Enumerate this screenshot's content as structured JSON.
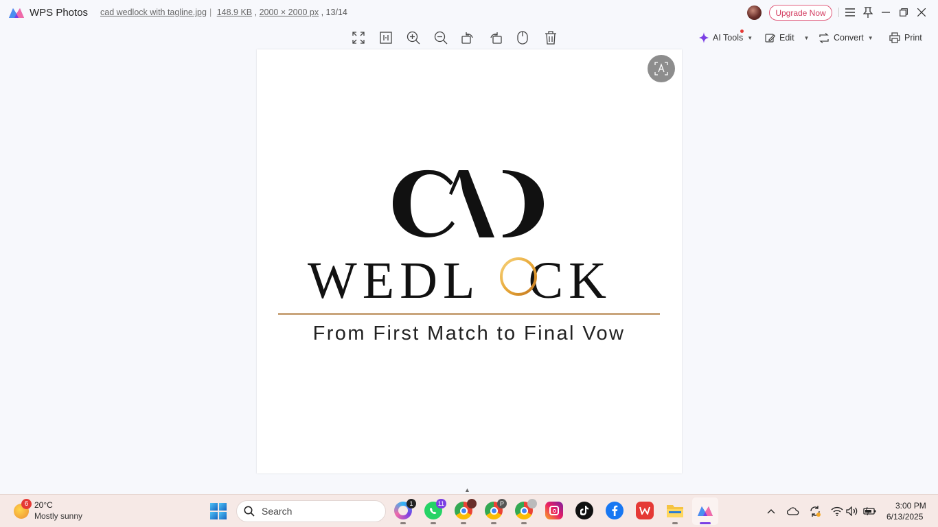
{
  "titlebar": {
    "app_name": "WPS Photos",
    "file_name": "cad wedlock with tagline.jpg",
    "file_size": "148.9 KB",
    "dimensions": "2000 × 2000 px",
    "position": "13/14",
    "upgrade_label": "Upgrade Now",
    "brand_color": "#7b3fe4"
  },
  "toolbar": {
    "icons": [
      "fullscreen-icon",
      "fit-size-icon",
      "zoom-in-icon",
      "zoom-out-icon",
      "rotate-left-icon",
      "rotate-right-icon",
      "pan-icon",
      "delete-icon"
    ],
    "ai_tools_label": "AI Tools",
    "edit_label": "Edit",
    "convert_label": "Convert",
    "print_label": "Print"
  },
  "image": {
    "monogram": "CAD",
    "wordmark_left": "WEDL",
    "wordmark_right": "CK",
    "tagline": "From First Match to Final Vow",
    "accent_gold": "#c9a57c",
    "ring_gold": "#e8a93a"
  },
  "taskbar": {
    "weather_badge": "6",
    "weather_temp": "20°C",
    "weather_desc": "Mostly sunny",
    "search_placeholder": "Search",
    "apps": [
      {
        "name": "copilot",
        "badge": "1"
      },
      {
        "name": "whatsapp",
        "badge": "11"
      },
      {
        "name": "chrome-profile-1",
        "badge": ""
      },
      {
        "name": "chrome-profile-p",
        "badge": "P"
      },
      {
        "name": "chrome-profile-3",
        "badge": ""
      },
      {
        "name": "instagram",
        "badge": ""
      },
      {
        "name": "tiktok",
        "badge": ""
      },
      {
        "name": "facebook",
        "badge": ""
      },
      {
        "name": "wps-office",
        "badge": ""
      },
      {
        "name": "file-explorer",
        "badge": ""
      },
      {
        "name": "wps-photos",
        "badge": ""
      }
    ],
    "clock_time": "3:00 PM",
    "clock_date": "6/13/2025"
  }
}
